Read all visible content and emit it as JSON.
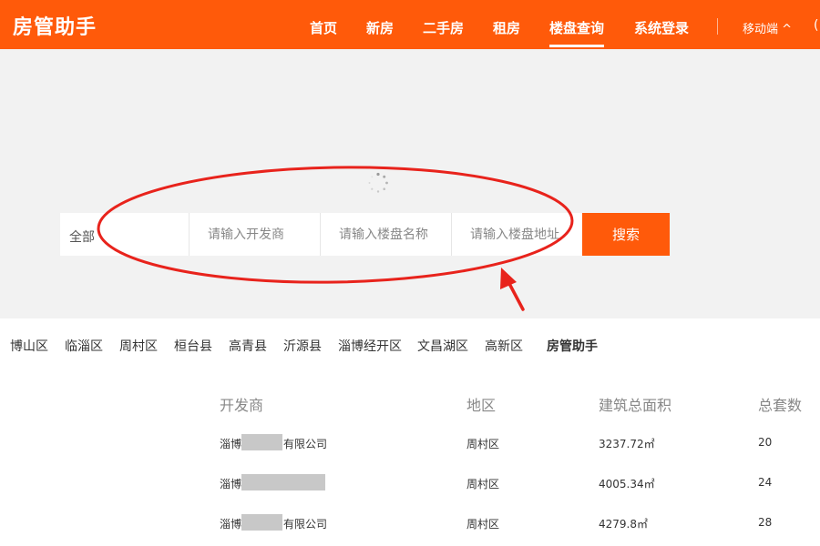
{
  "header": {
    "logo": "房管助手",
    "nav": [
      {
        "label": "首页"
      },
      {
        "label": "新房"
      },
      {
        "label": "二手房"
      },
      {
        "label": "租房"
      },
      {
        "label": "楼盘查询",
        "active": true
      },
      {
        "label": "系统登录"
      }
    ],
    "mobile_label": "移动端 ^",
    "edge_text": "("
  },
  "search": {
    "select_value": "全部",
    "developer_placeholder": "请输入开发商",
    "name_placeholder": "请输入楼盘名称",
    "address_placeholder": "请输入楼盘地址",
    "button_label": "搜索"
  },
  "districts": [
    "博山区",
    "临淄区",
    "周村区",
    "桓台县",
    "高青县",
    "沂源县",
    "淄博经开区",
    "文昌湖区",
    "高新区",
    "房管助手"
  ],
  "table": {
    "headers": [
      "开发商",
      "地区",
      "建筑总面积",
      "总套数"
    ],
    "rows": [
      {
        "dev_prefix": "淄博",
        "dev_suffix": "有限公司",
        "region": "周村区",
        "area": "3237.72㎡",
        "units": "20"
      },
      {
        "dev_prefix": "淄博",
        "dev_suffix": "",
        "region": "周村区",
        "area": "4005.34㎡",
        "units": "24"
      },
      {
        "dev_prefix": "淄博",
        "dev_suffix": "有限公司",
        "region": "周村区",
        "area": "4279.8㎡",
        "units": "28"
      }
    ]
  },
  "colors": {
    "brand_orange": "#ff5a0a",
    "annotation_red": "#e8231c",
    "banner_gray": "#f2f2f2"
  },
  "icons": [
    "loading-spinner-icon",
    "dropdown-caret-icon",
    "annotation-arrow-icon"
  ]
}
